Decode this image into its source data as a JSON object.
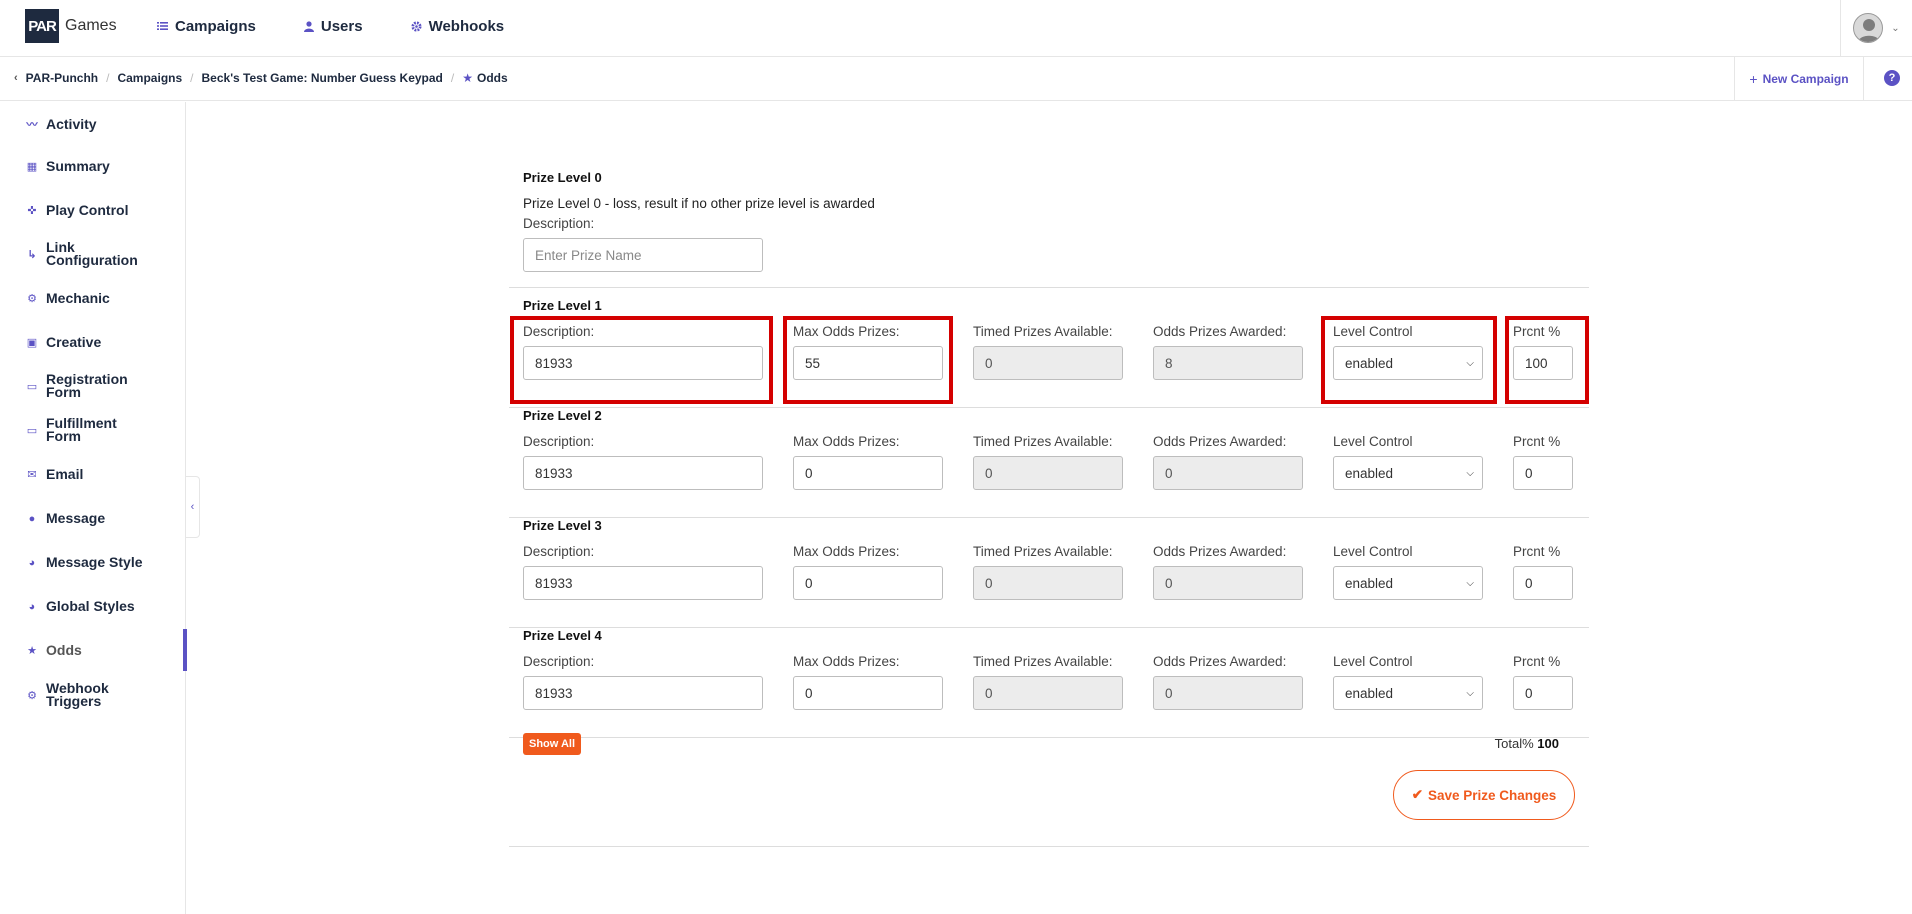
{
  "brand": {
    "logo_mark": "PAR",
    "logo_text": "Games"
  },
  "nav": [
    {
      "label": "Campaigns",
      "icon": "list-icon"
    },
    {
      "label": "Users",
      "icon": "user-icon"
    },
    {
      "label": "Webhooks",
      "icon": "gear-icon"
    }
  ],
  "breadcrumb": {
    "items": [
      "PAR-Punchh",
      "Campaigns",
      "Beck's Test Game: Number Guess Keypad",
      "Odds"
    ]
  },
  "header_actions": {
    "new_campaign": "New Campaign",
    "help": "?"
  },
  "sidebar": {
    "items": [
      {
        "label": "Activity",
        "icon": "chart-line-icon"
      },
      {
        "label": "Summary",
        "icon": "dashboard-icon"
      },
      {
        "label": "Play Control",
        "icon": "gamepad-icon"
      },
      {
        "label": "Link Configuration",
        "icon": "link-arrow-icon"
      },
      {
        "label": "Mechanic",
        "icon": "gear-icon"
      },
      {
        "label": "Creative",
        "icon": "image-icon"
      },
      {
        "label": "Registration Form",
        "icon": "form-icon"
      },
      {
        "label": "Fulfillment Form",
        "icon": "form-icon"
      },
      {
        "label": "Email",
        "icon": "envelope-icon"
      },
      {
        "label": "Message",
        "icon": "info-icon"
      },
      {
        "label": "Message Style",
        "icon": "palette-icon"
      },
      {
        "label": "Global Styles",
        "icon": "palette-icon"
      },
      {
        "label": "Odds",
        "icon": "star-icon",
        "active": true
      },
      {
        "label": "Webhook Triggers",
        "icon": "gear-icon"
      }
    ]
  },
  "level0": {
    "title": "Prize Level 0",
    "text": "Prize Level 0 - loss, result if no other prize level is awarded",
    "description_label": "Description:",
    "description_placeholder": "Enter Prize Name"
  },
  "labels": {
    "description": "Description:",
    "max_odds": "Max Odds Prizes:",
    "timed_available": "Timed Prizes Available:",
    "odds_awarded": "Odds Prizes Awarded:",
    "level_control": "Level Control",
    "prcnt": "Prcnt %"
  },
  "levels": [
    {
      "title": "Prize Level 1",
      "description": "81933",
      "max_odds": "55",
      "timed_available": "0",
      "odds_awarded": "8",
      "level_control": "enabled",
      "prcnt": "100"
    },
    {
      "title": "Prize Level 2",
      "description": "81933",
      "max_odds": "0",
      "timed_available": "0",
      "odds_awarded": "0",
      "level_control": "enabled",
      "prcnt": "0"
    },
    {
      "title": "Prize Level 3",
      "description": "81933",
      "max_odds": "0",
      "timed_available": "0",
      "odds_awarded": "0",
      "level_control": "enabled",
      "prcnt": "0"
    },
    {
      "title": "Prize Level 4",
      "description": "81933",
      "max_odds": "0",
      "timed_available": "0",
      "odds_awarded": "0",
      "level_control": "enabled",
      "prcnt": "0"
    }
  ],
  "footer": {
    "show_all": "Show All",
    "total_label": "Total%",
    "total_value": "100",
    "save_label": "Save Prize Changes"
  },
  "colors": {
    "accent": "#5b52c4",
    "brand_dark": "#1e2a3f",
    "orange": "#f05a1d",
    "highlight": "#d40000"
  }
}
